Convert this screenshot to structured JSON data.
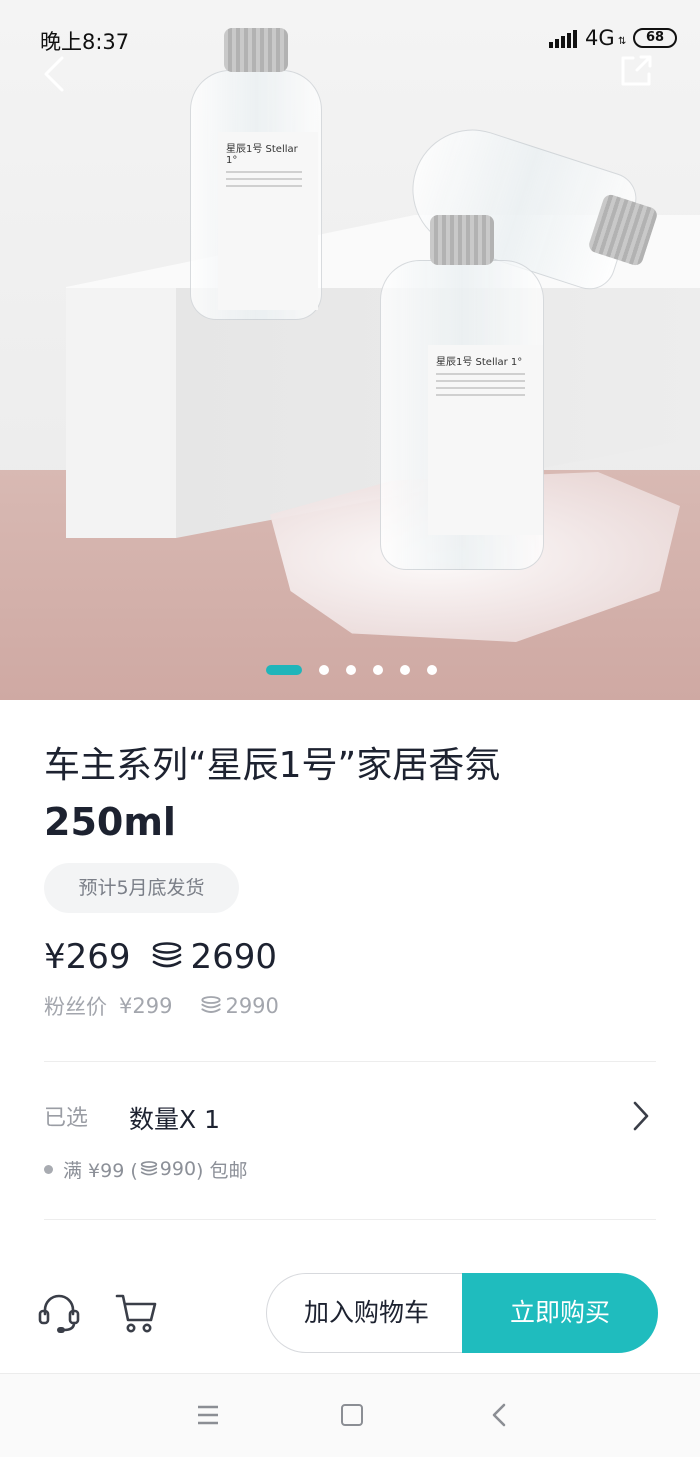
{
  "status_bar": {
    "time": "晚上8:37",
    "network": "4G",
    "network_arrows": "⇅",
    "battery": "68"
  },
  "hero": {
    "bottle_label_name": "星辰1号 Stellar 1°",
    "carousel": {
      "count": 6,
      "active_index": 0
    },
    "accent_color": "#1fb5ba"
  },
  "product": {
    "title_line1": "车主系列“星辰1号”家居香氛",
    "title_line2": "250ml",
    "ship_badge": "预计5月底发货",
    "price": "¥269",
    "coin_price": "2690",
    "fan_label": "粉丝价",
    "fan_price": "¥299",
    "fan_coin_price": "2990"
  },
  "selection": {
    "label": "已选",
    "value": "数量X 1",
    "shipping_prefix": "满 ¥99 (",
    "shipping_coin": "990",
    "shipping_suffix": ") 包邮"
  },
  "actions": {
    "add_to_cart": "加入购物车",
    "buy_now": "立即购买",
    "buy_color": "#1fbcbe"
  },
  "icons": [
    "back-icon",
    "share-icon",
    "coin-icon",
    "chevron-right-icon",
    "customer-service-icon",
    "cart-icon",
    "menu-icon",
    "home-icon",
    "nav-back-icon"
  ]
}
